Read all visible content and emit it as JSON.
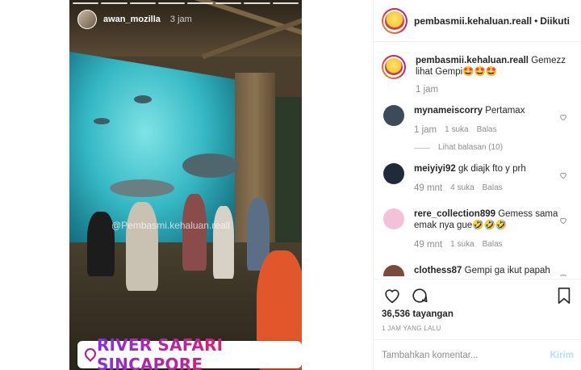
{
  "story": {
    "username": "awan_mozilla",
    "time": "3 jam",
    "watermark": "@Pembasmi.kehaluan.reall",
    "location_sticker": "RIVER SAFARI SINCAPORE",
    "progress_segments": 8
  },
  "header": {
    "username": "pembasmii.kehaluan.reall",
    "separator": "•",
    "follow_label": "Diikuti"
  },
  "caption": {
    "username": "pembasmii.kehaluan.reall",
    "text": "Gemezz lihat Gempi🤩🤩🤩",
    "time": "1 jam"
  },
  "comments": [
    {
      "username": "mynameiscorry",
      "text": "Pertamax",
      "time": "1 jam",
      "likes": "1 suka",
      "reply_label": "Balas",
      "view_replies": "Lihat balasan (10)",
      "avatar_color": "#3d4a5a"
    },
    {
      "username": "meiyiyi92",
      "text": "gk diajk fto y prh",
      "time": "49 mnt",
      "likes": "4 suka",
      "reply_label": "Balas",
      "avatar_color": "#1f2a3a"
    },
    {
      "username": "rere_collection899",
      "text": "Gemess sama emak nya gue🤣🤣🤣",
      "time": "49 mnt",
      "likes": "1 suka",
      "reply_label": "Balas",
      "avatar_color": "#f3c1d8"
    },
    {
      "username": "clothess87",
      "text": "Gempi ga ikut papah",
      "avatar_color": "#7a4a3a"
    }
  ],
  "stats": {
    "views": "36,536 tayangan",
    "posted_ago": "1 JAM YANG LALU"
  },
  "comment_box": {
    "placeholder": "Tambahkan komentar...",
    "post_label": "Kirim"
  },
  "icons": {
    "like": "heart-icon",
    "comment": "comment-bubble-icon",
    "save": "bookmark-icon",
    "location": "location-pin-icon"
  },
  "colors": {
    "sticker_gradient_start": "#8a2be2",
    "sticker_gradient_end": "#e63d3d",
    "post_button_disabled": "#b2dffc",
    "muted_text": "#8e8e8e"
  }
}
